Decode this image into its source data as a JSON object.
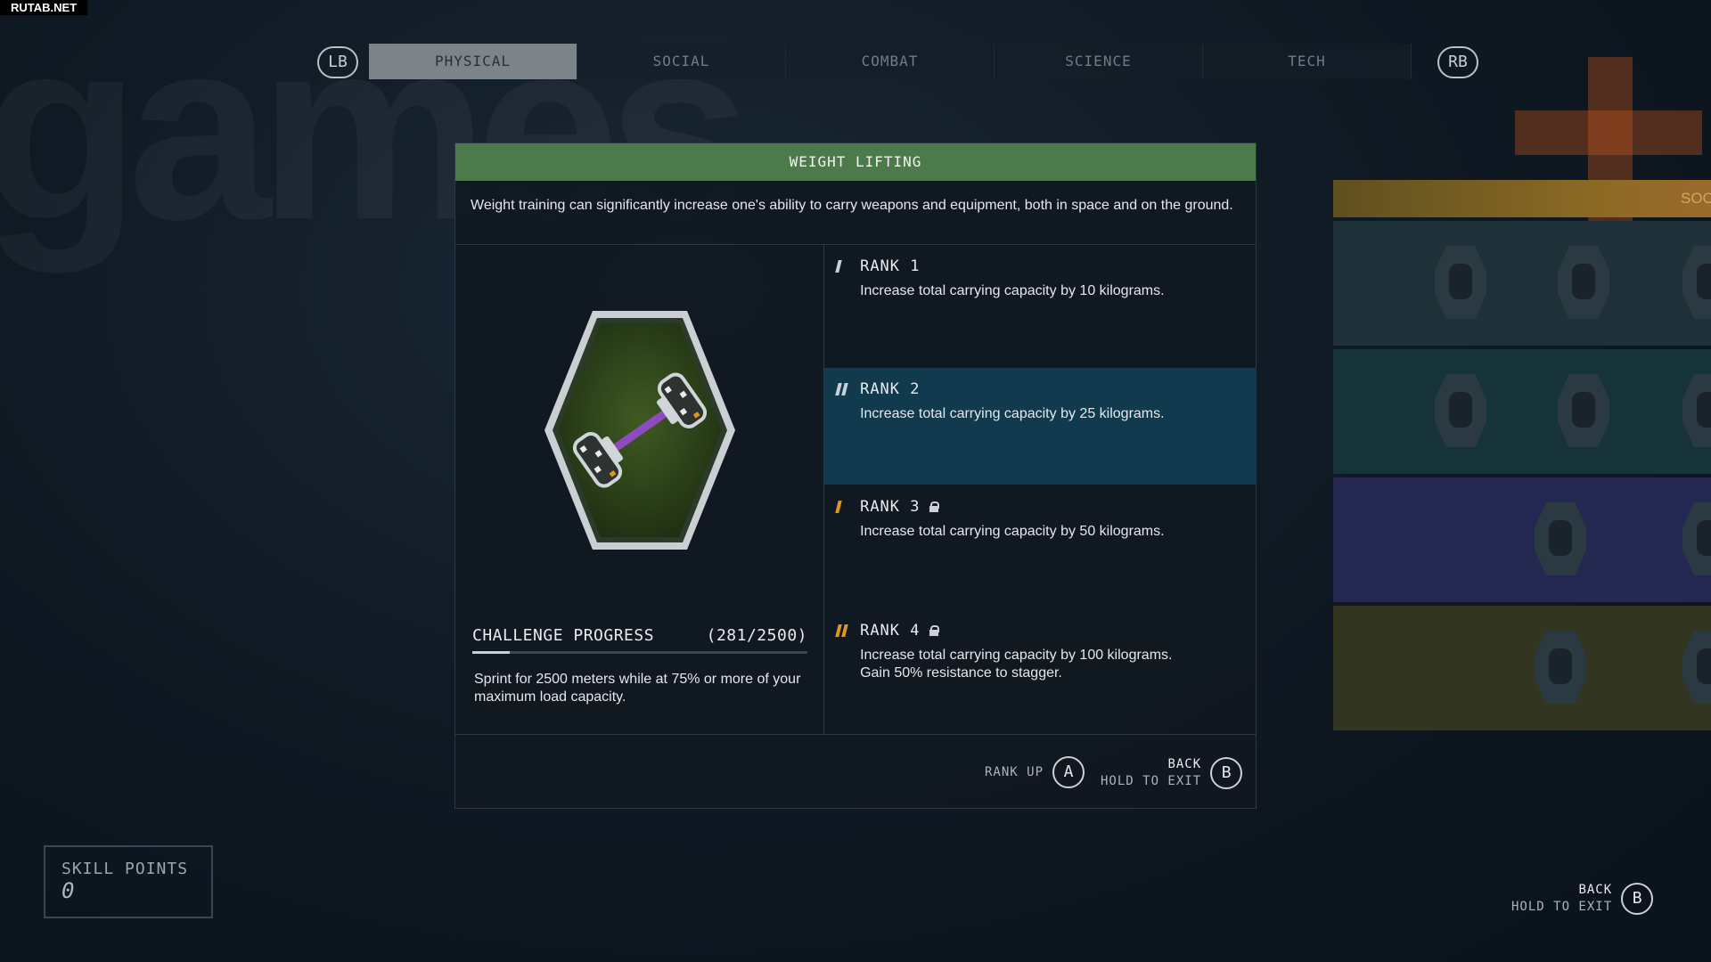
{
  "watermark": {
    "site": "RUTAB.NET",
    "background_text": "games"
  },
  "nav": {
    "left_bumper": "LB",
    "right_bumper": "RB",
    "tabs": [
      {
        "label": "PHYSICAL",
        "active": true
      },
      {
        "label": "SOCIAL",
        "active": false
      },
      {
        "label": "COMBAT",
        "active": false
      },
      {
        "label": "SCIENCE",
        "active": false
      },
      {
        "label": "TECH",
        "active": false
      }
    ]
  },
  "skill": {
    "title": "WEIGHT LIFTING",
    "description": "Weight training can significantly increase one's ability to carry weapons and equipment, both in space and on the ground.",
    "badge_icon": "dumbbell-icon",
    "challenge": {
      "label": "CHALLENGE PROGRESS",
      "progress_text": "(281/2500)",
      "current": 281,
      "total": 2500,
      "description": "Sprint for 2500 meters while at 75% or more of your maximum load capacity."
    },
    "ranks": [
      {
        "label": "RANK 1",
        "text": "Increase total carrying capacity by 10 kilograms.",
        "locked": false,
        "selected": false
      },
      {
        "label": "RANK 2",
        "text": "Increase total carrying capacity by 25 kilograms.",
        "locked": false,
        "selected": true
      },
      {
        "label": "RANK 3",
        "text": "Increase total carrying capacity by 50 kilograms.",
        "locked": true,
        "selected": false
      },
      {
        "label": "RANK 4",
        "text": "Increase total carrying capacity by 100 kilograms.\nGain 50% resistance to stagger.",
        "locked": true,
        "selected": false
      }
    ]
  },
  "footer": {
    "rank_up_label": "RANK UP",
    "rank_up_button": "A",
    "back_label": "BACK",
    "hold_label": "HOLD TO EXIT",
    "back_button": "B"
  },
  "side_panel": {
    "header": "SOCIAL"
  },
  "skill_points": {
    "label": "SKILL POINTS",
    "value": "0"
  },
  "screen_footer": {
    "back_label": "BACK",
    "hold_label": "HOLD TO EXIT",
    "back_button": "B"
  },
  "colors": {
    "header_green": "#4d7a4b",
    "selected_rank": "#123a4f",
    "pip_orange": "#e0961e",
    "active_tab": "#7c8389"
  }
}
